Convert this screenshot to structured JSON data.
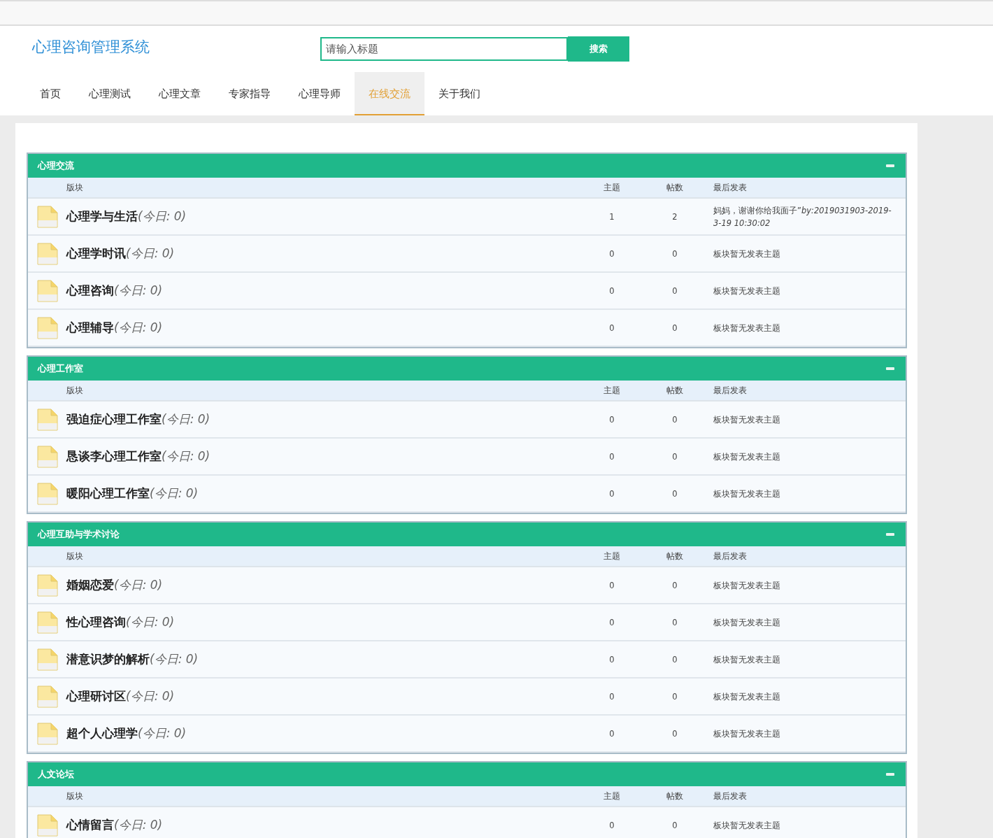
{
  "site_title": "心理咨询管理系统",
  "search": {
    "placeholder": "请输入标题",
    "button": "搜索"
  },
  "nav": [
    {
      "label": "首页",
      "selected": false
    },
    {
      "label": "心理测试",
      "selected": false
    },
    {
      "label": "心理文章",
      "selected": false
    },
    {
      "label": "专家指导",
      "selected": false
    },
    {
      "label": "心理导师",
      "selected": false
    },
    {
      "label": "在线交流",
      "selected": true
    },
    {
      "label": "关于我们",
      "selected": false
    }
  ],
  "sections": [
    {
      "title": "心理交流",
      "columns": [
        "版块",
        "主题",
        "帖数",
        "最后发表"
      ],
      "forums": [
        {
          "name": "心理学与生活",
          "today": "(今日: 0)",
          "topics": "1",
          "posts": "2",
          "last_post": "妈妈，谢谢你给我面子”*by:2019031903-2019-3-19 10:30:02*"
        },
        {
          "name": "心理学时讯",
          "today": "(今日: 0)",
          "topics": "0",
          "posts": "0",
          "last_post": "板块暂无发表主题"
        },
        {
          "name": "心理咨询",
          "today": "(今日: 0)",
          "topics": "0",
          "posts": "0",
          "last_post": "板块暂无发表主题"
        },
        {
          "name": "心理辅导",
          "today": "(今日: 0)",
          "topics": "0",
          "posts": "0",
          "last_post": "板块暂无发表主题"
        }
      ]
    },
    {
      "title": "心理工作室",
      "columns": [
        "版块",
        "主题",
        "帖数",
        "最后发表"
      ],
      "forums": [
        {
          "name": "强迫症心理工作室",
          "today": "(今日: 0)",
          "topics": "0",
          "posts": "0",
          "last_post": "板块暂无发表主题"
        },
        {
          "name": "恳谈李心理工作室",
          "today": "(今日: 0)",
          "topics": "0",
          "posts": "0",
          "last_post": "板块暂无发表主题"
        },
        {
          "name": "暖阳心理工作室",
          "today": "(今日: 0)",
          "topics": "0",
          "posts": "0",
          "last_post": "板块暂无发表主题"
        }
      ]
    },
    {
      "title": "心理互助与学术讨论",
      "columns": [
        "版块",
        "主题",
        "帖数",
        "最后发表"
      ],
      "forums": [
        {
          "name": "婚姻恋爱",
          "today": "(今日: 0)",
          "topics": "0",
          "posts": "0",
          "last_post": "板块暂无发表主题"
        },
        {
          "name": "性心理咨询",
          "today": "(今日: 0)",
          "topics": "0",
          "posts": "0",
          "last_post": "板块暂无发表主题"
        },
        {
          "name": "潜意识梦的解析",
          "today": "(今日: 0)",
          "topics": "0",
          "posts": "0",
          "last_post": "板块暂无发表主题"
        },
        {
          "name": "心理研讨区",
          "today": "(今日: 0)",
          "topics": "0",
          "posts": "0",
          "last_post": "板块暂无发表主题"
        },
        {
          "name": "超个人心理学",
          "today": "(今日: 0)",
          "topics": "0",
          "posts": "0",
          "last_post": "板块暂无发表主题"
        }
      ]
    },
    {
      "title": "人文论坛",
      "columns": [
        "版块",
        "主题",
        "帖数",
        "最后发表"
      ],
      "forums": [
        {
          "name": "心情留言",
          "today": "(今日: 0)",
          "topics": "0",
          "posts": "0",
          "last_post": "板块暂无发表主题"
        }
      ]
    }
  ]
}
